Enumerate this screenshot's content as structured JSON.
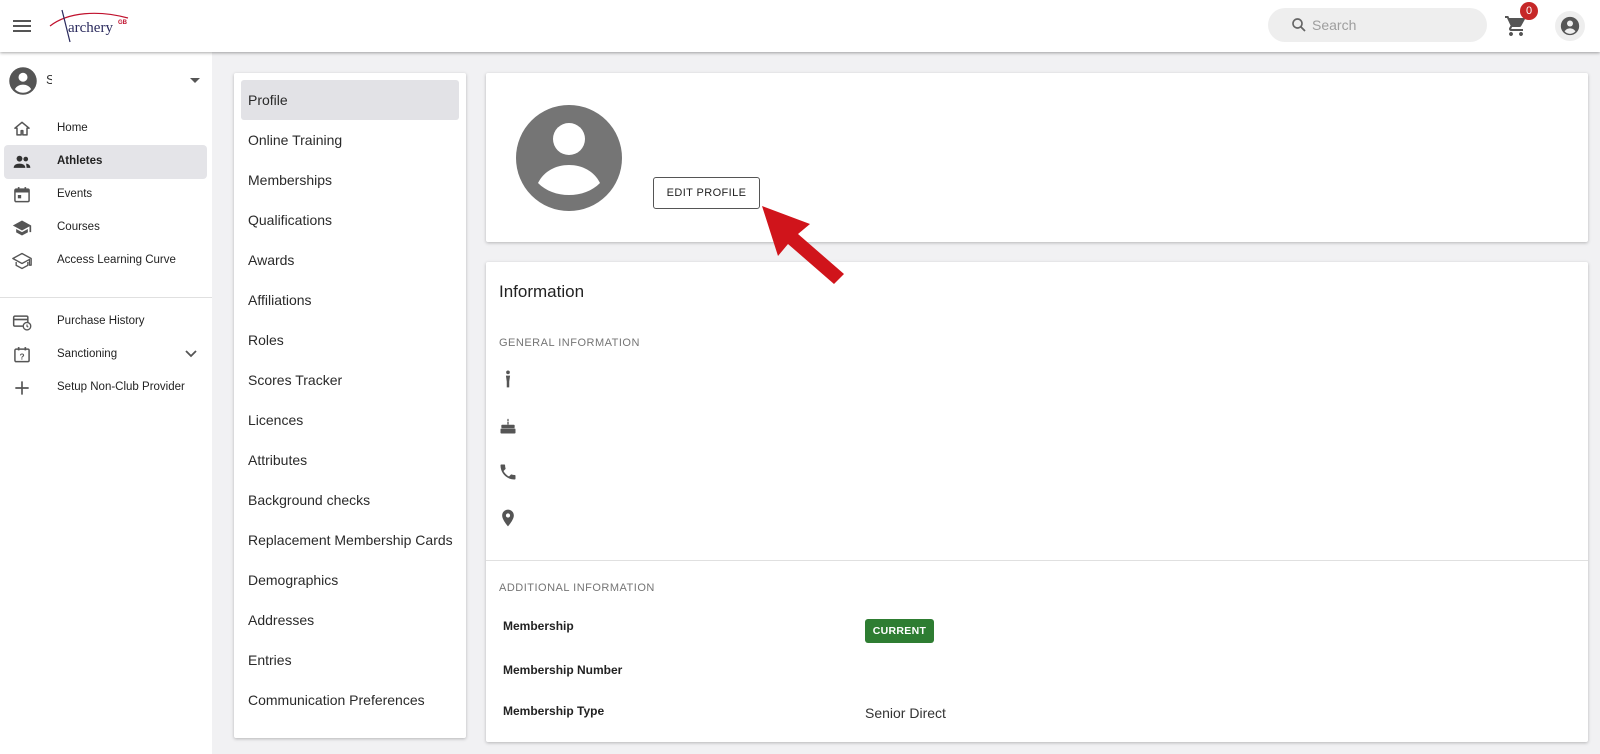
{
  "header": {
    "logo_text": "archery",
    "logo_suffix": "GB",
    "search_placeholder": "Search",
    "cart_count": "0"
  },
  "user": {
    "name": "S"
  },
  "leftnav": {
    "items": [
      {
        "label": "Home",
        "icon": "home-icon"
      },
      {
        "label": "Athletes",
        "icon": "people-icon",
        "active": true
      },
      {
        "label": "Events",
        "icon": "calendar-icon"
      },
      {
        "label": "Courses",
        "icon": "school-icon"
      },
      {
        "label": "Access Learning Curve",
        "icon": "school-outline-icon"
      },
      {
        "label": "Purchase History",
        "icon": "purchase-history-icon"
      },
      {
        "label": "Sanctioning",
        "icon": "calendar-question-icon"
      },
      {
        "label": "Setup Non-Club Provider",
        "icon": "plus-icon"
      }
    ]
  },
  "sidemenu": {
    "items": [
      "Profile",
      "Online Training",
      "Memberships",
      "Qualifications",
      "Awards",
      "Affiliations",
      "Roles",
      "Scores Tracker",
      "Licences",
      "Attributes",
      "Background checks",
      "Replacement Membership Cards",
      "Demographics",
      "Addresses",
      "Entries",
      "Communication Preferences"
    ],
    "active": "Profile"
  },
  "profile": {
    "edit_label": "EDIT PROFILE"
  },
  "info": {
    "title": "Information",
    "general_title": "GENERAL INFORMATION",
    "additional_title": "ADDITIONAL INFORMATION",
    "fields": {
      "membership_label": "Membership",
      "membership_status": "CURRENT",
      "number_label": "Membership Number",
      "type_label": "Membership Type",
      "type_value": "Senior Direct"
    }
  },
  "colors": {
    "accent_red": "#c62828",
    "status_green": "#2e7d32",
    "annotation_arrow": "#d0141b"
  }
}
